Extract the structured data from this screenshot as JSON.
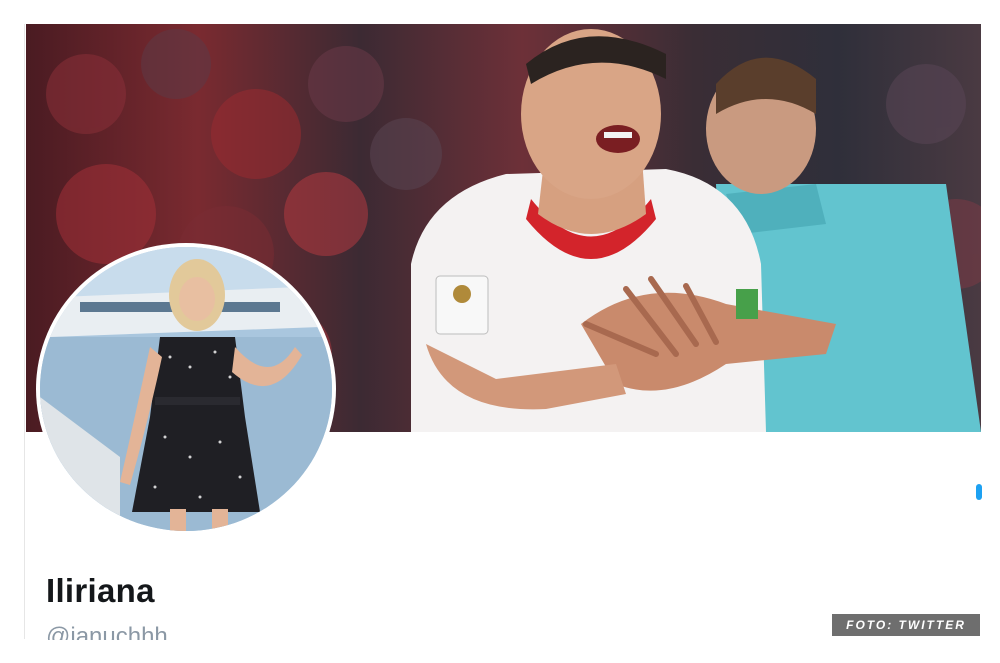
{
  "profile": {
    "display_name": "Iliriana",
    "handle": "@ianuchhh"
  },
  "photo_credit": "FOTO: TWITTER",
  "images": {
    "banner": "header-photo-footballer",
    "avatar": "profile-photo-woman"
  },
  "colors": {
    "accent": "#1da1f2",
    "name_text": "#14171a",
    "handle_text": "#8b98a5",
    "credit_bg": "#6e6e6e"
  }
}
